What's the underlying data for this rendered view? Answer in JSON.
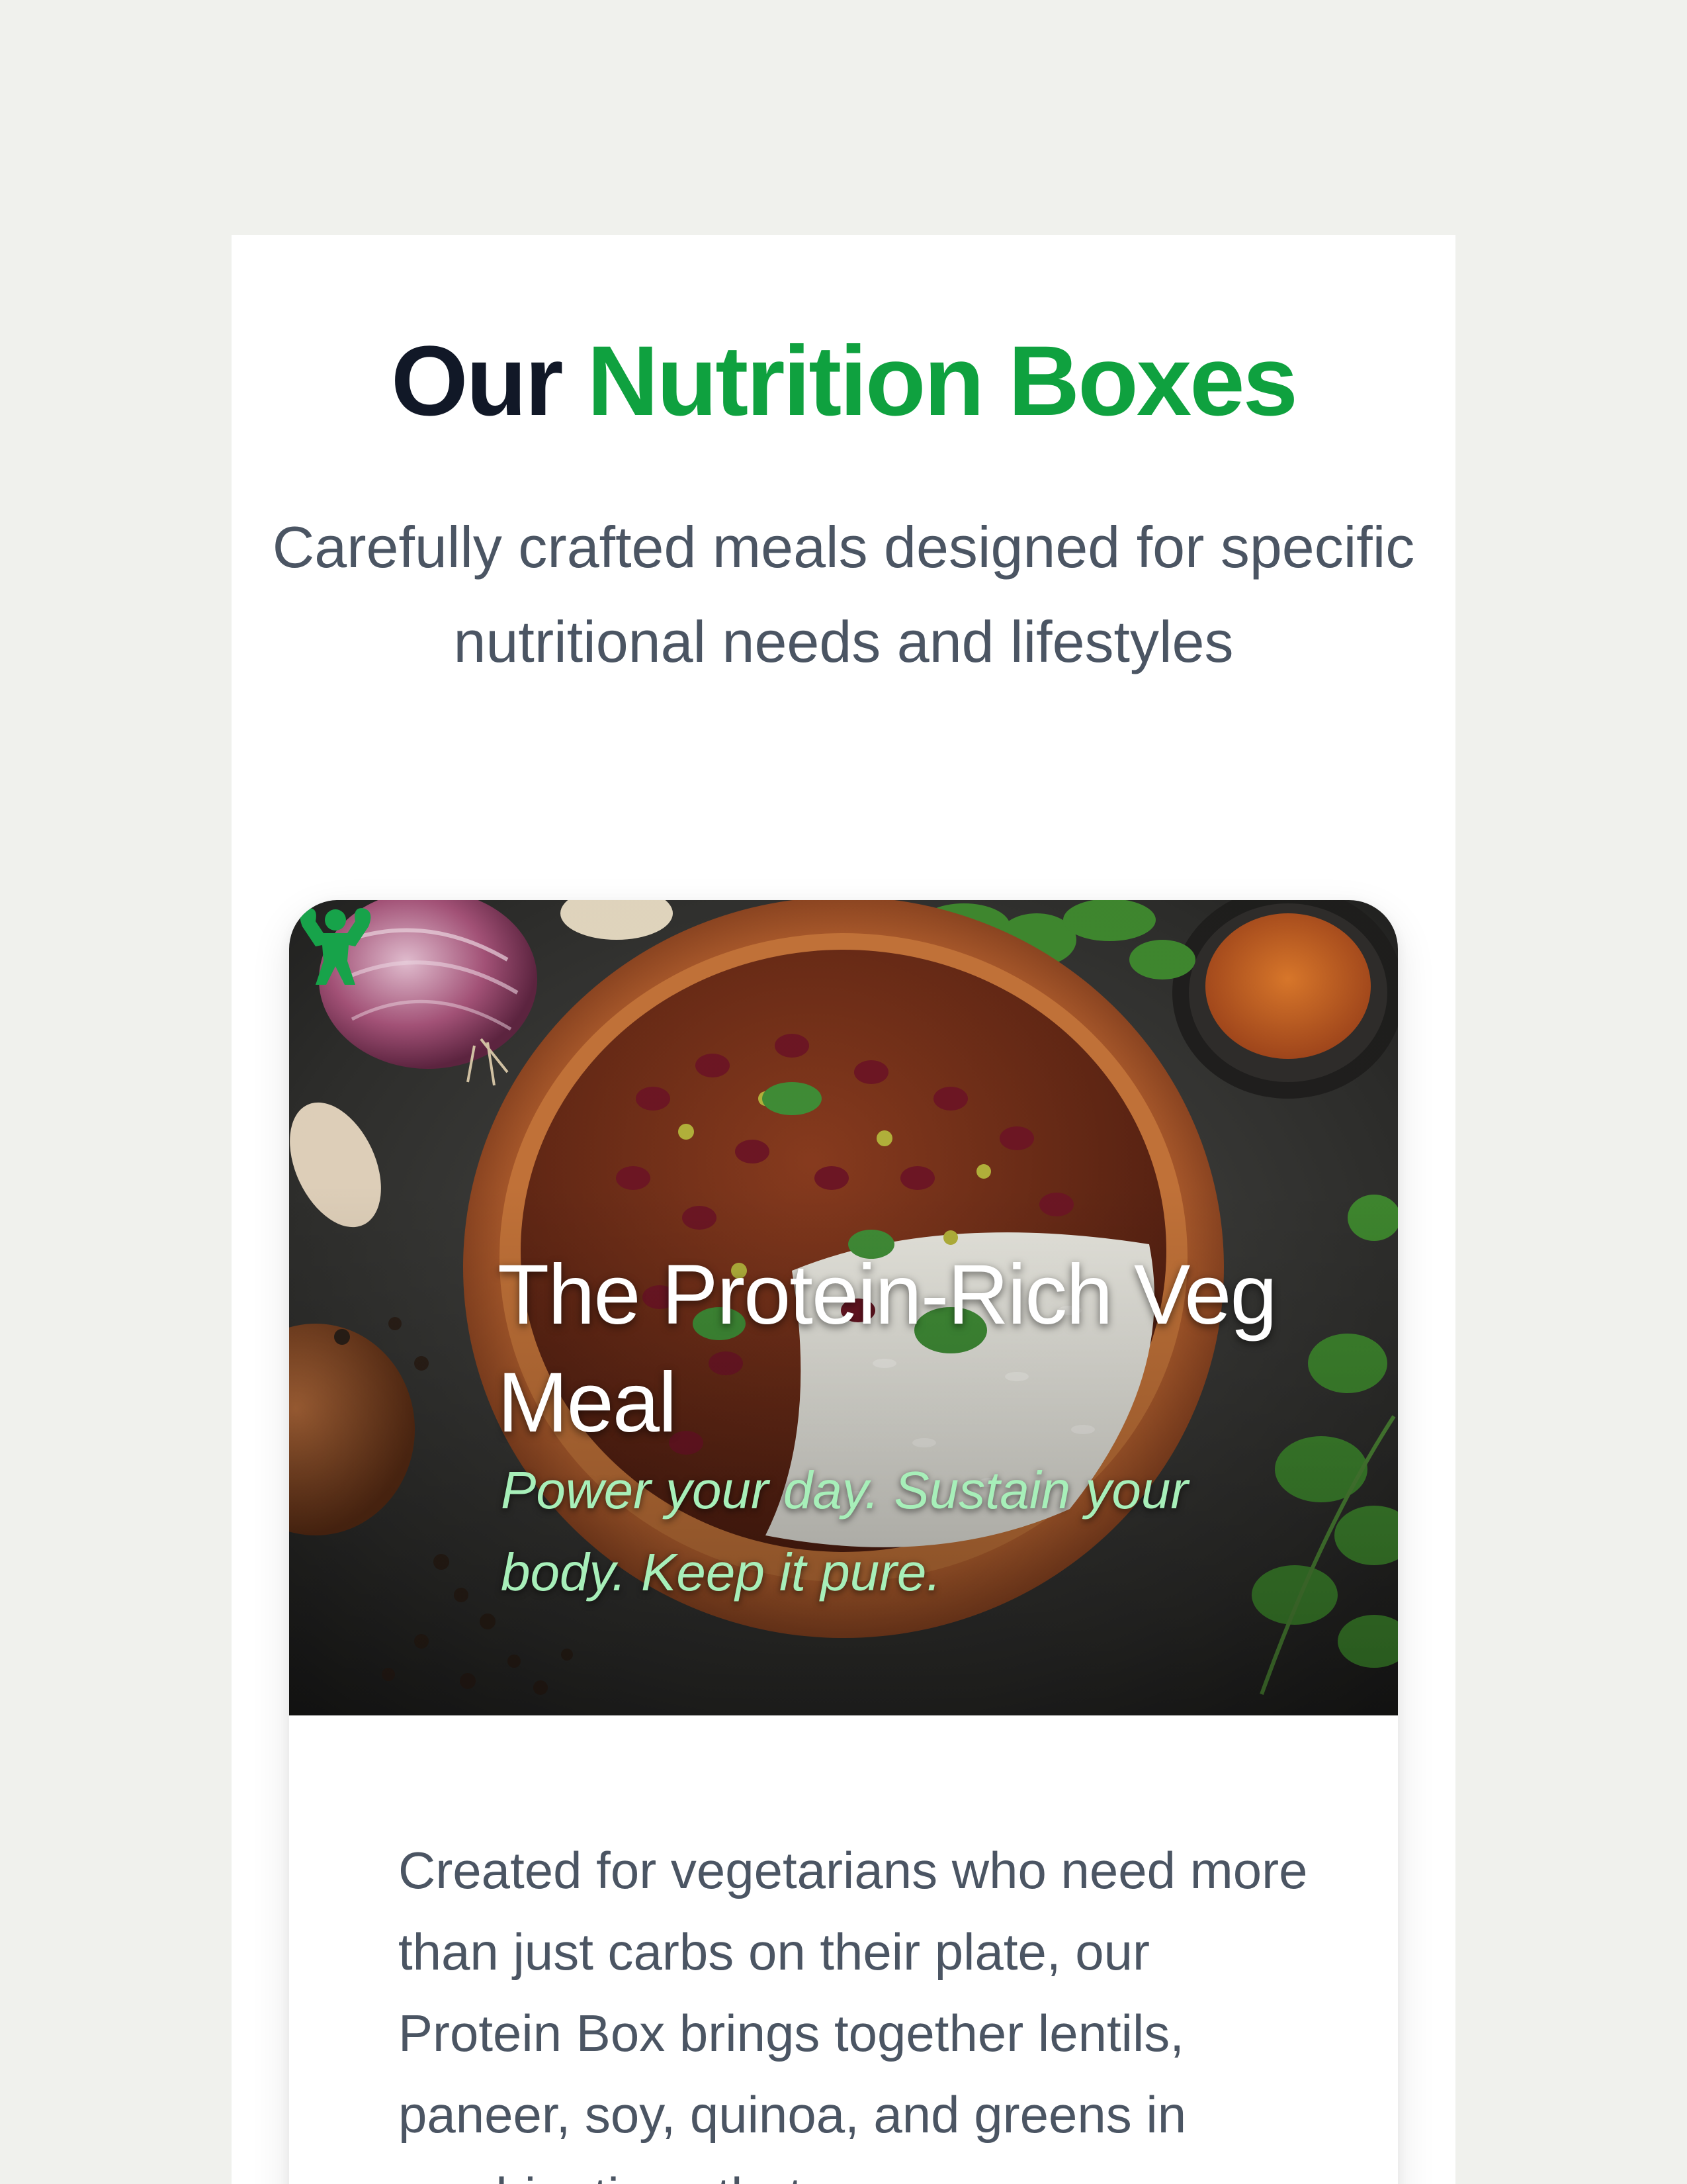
{
  "section": {
    "title_prefix": "Our",
    "title_accent": "Nutrition Boxes",
    "subtitle": "Carefully crafted meals designed for specific nutritional needs and lifestyles"
  },
  "card": {
    "image_icon": "flexed-muscle-icon",
    "title": "The Protein-Rich Veg Meal",
    "tagline": "Power your day. Sustain your body. Keep it pure.",
    "description": "Created for vegetarians who need more than just carbs on their plate, our Protein Box brings together lentils, paneer, soy, quinoa, and greens in combinations that are so"
  },
  "colors": {
    "background": "#f0f1ed",
    "accent_green": "#0fa13f",
    "heading_dark": "#111827",
    "body_gray": "#4b5563",
    "tagline_green": "#a7efb9"
  }
}
